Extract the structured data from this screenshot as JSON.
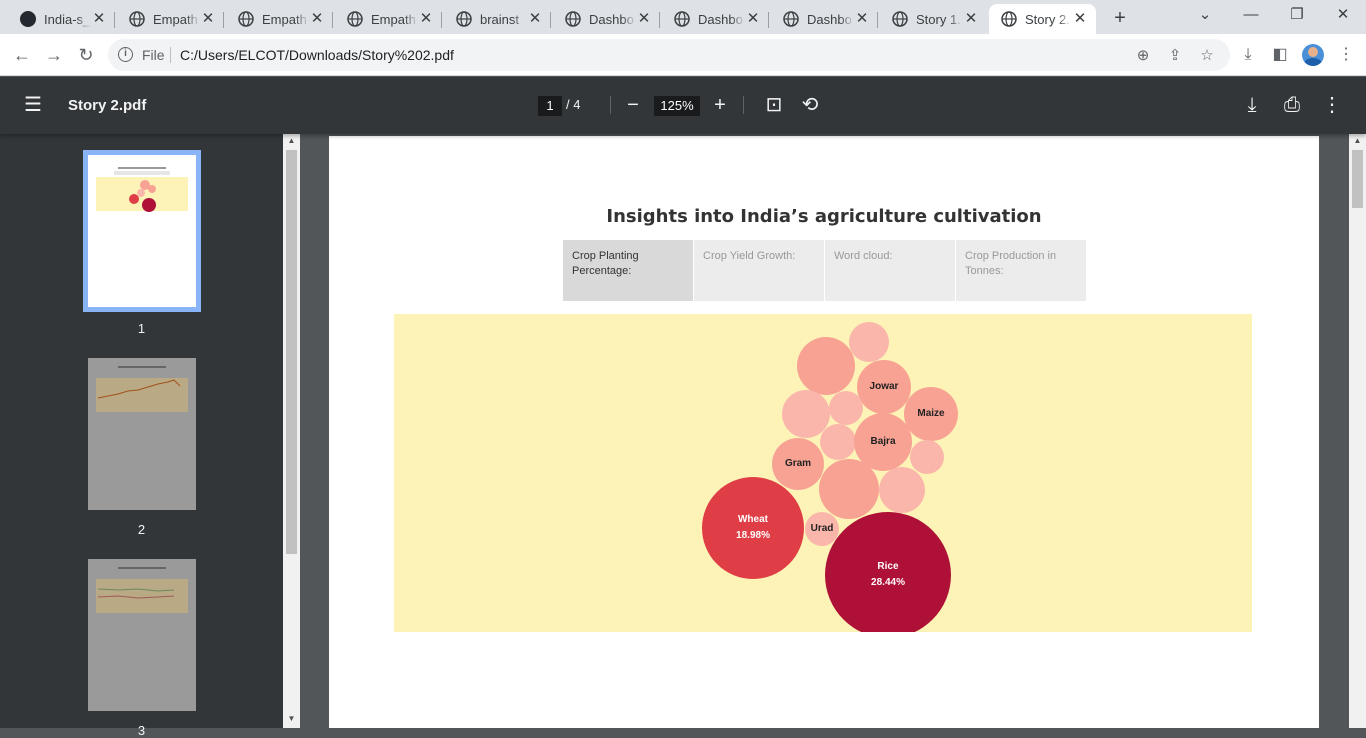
{
  "browser": {
    "tabs": [
      {
        "title": "India-s_",
        "icon": "github-icon"
      },
      {
        "title": "Empath",
        "icon": "globe-icon"
      },
      {
        "title": "Empath",
        "icon": "globe-icon"
      },
      {
        "title": "Empath",
        "icon": "globe-icon"
      },
      {
        "title": "brainst",
        "icon": "globe-icon"
      },
      {
        "title": "Dashbo",
        "icon": "globe-icon"
      },
      {
        "title": "Dashbo",
        "icon": "globe-icon"
      },
      {
        "title": "Dashbo",
        "icon": "globe-icon"
      },
      {
        "title": "Story 1.",
        "icon": "globe-icon"
      },
      {
        "title": "Story 2.",
        "icon": "globe-icon",
        "active": true
      }
    ],
    "address": {
      "scheme": "File",
      "url": "C:/Users/ELCOT/Downloads/Story%202.pdf"
    }
  },
  "pdf_viewer": {
    "filename": "Story 2.pdf",
    "current_page": "1",
    "page_total": "/ 4",
    "zoom": "125%",
    "thumbnails": [
      "1",
      "2",
      "3"
    ]
  },
  "document": {
    "title": "Insights into India’s agriculture cultivation",
    "story_tabs": [
      {
        "label": "Crop Planting Percentage:",
        "current": true
      },
      {
        "label": "Crop Yield Growth:",
        "current": false
      },
      {
        "label": "Word cloud:",
        "current": false
      },
      {
        "label": "Crop Production in Tonnes:",
        "current": false
      }
    ],
    "bubbles": [
      {
        "name": "Rice",
        "value": "28.44%"
      },
      {
        "name": "Wheat",
        "value": "18.98%"
      },
      {
        "name": "Jowar"
      },
      {
        "name": "Maize"
      },
      {
        "name": "Bajra"
      },
      {
        "name": "Gram"
      },
      {
        "name": "Urad"
      }
    ],
    "colors": {
      "rice": "#ae1037",
      "wheat": "#e03e46",
      "mid": "#f8a294",
      "light": "#fbb6ac",
      "background": "#fdf3b7"
    }
  }
}
